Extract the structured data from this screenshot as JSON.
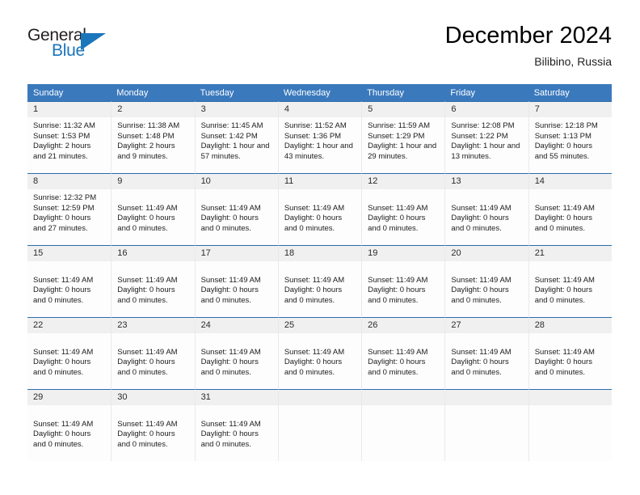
{
  "logo": {
    "text_primary": "General",
    "text_secondary": "Blue",
    "triangle_color": "#1b75bb"
  },
  "header": {
    "title": "December 2024",
    "subtitle": "Bilibino, Russia"
  },
  "theme": {
    "header_blue": "#3b79bd",
    "cell_border_blue": "#2b6cad",
    "daynum_strip_gray": "#f0f0f0",
    "cell_background": "#fdfdfd"
  },
  "calendar": {
    "weekday_headers": [
      "Sunday",
      "Monday",
      "Tuesday",
      "Wednesday",
      "Thursday",
      "Friday",
      "Saturday"
    ],
    "weeks": [
      [
        {
          "day": "1",
          "lines": [
            "Sunrise: 11:32 AM",
            "Sunset: 1:53 PM",
            "Daylight: 2 hours",
            "and 21 minutes."
          ]
        },
        {
          "day": "2",
          "lines": [
            "Sunrise: 11:38 AM",
            "Sunset: 1:48 PM",
            "Daylight: 2 hours",
            "and 9 minutes."
          ]
        },
        {
          "day": "3",
          "lines": [
            "Sunrise: 11:45 AM",
            "Sunset: 1:42 PM",
            "Daylight: 1 hour and",
            "57 minutes."
          ]
        },
        {
          "day": "4",
          "lines": [
            "Sunrise: 11:52 AM",
            "Sunset: 1:36 PM",
            "Daylight: 1 hour and",
            "43 minutes."
          ]
        },
        {
          "day": "5",
          "lines": [
            "Sunrise: 11:59 AM",
            "Sunset: 1:29 PM",
            "Daylight: 1 hour and",
            "29 minutes."
          ]
        },
        {
          "day": "6",
          "lines": [
            "Sunrise: 12:08 PM",
            "Sunset: 1:22 PM",
            "Daylight: 1 hour and",
            "13 minutes."
          ]
        },
        {
          "day": "7",
          "lines": [
            "Sunrise: 12:18 PM",
            "Sunset: 1:13 PM",
            "Daylight: 0 hours",
            "and 55 minutes."
          ]
        }
      ],
      [
        {
          "day": "8",
          "lines": [
            "Sunrise: 12:32 PM",
            "Sunset: 12:59 PM",
            "Daylight: 0 hours",
            "and 27 minutes."
          ]
        },
        {
          "day": "9",
          "lines": [
            "",
            "Sunset: 11:49 AM",
            "Daylight: 0 hours",
            "and 0 minutes."
          ]
        },
        {
          "day": "10",
          "lines": [
            "",
            "Sunset: 11:49 AM",
            "Daylight: 0 hours",
            "and 0 minutes."
          ]
        },
        {
          "day": "11",
          "lines": [
            "",
            "Sunset: 11:49 AM",
            "Daylight: 0 hours",
            "and 0 minutes."
          ]
        },
        {
          "day": "12",
          "lines": [
            "",
            "Sunset: 11:49 AM",
            "Daylight: 0 hours",
            "and 0 minutes."
          ]
        },
        {
          "day": "13",
          "lines": [
            "",
            "Sunset: 11:49 AM",
            "Daylight: 0 hours",
            "and 0 minutes."
          ]
        },
        {
          "day": "14",
          "lines": [
            "",
            "Sunset: 11:49 AM",
            "Daylight: 0 hours",
            "and 0 minutes."
          ]
        }
      ],
      [
        {
          "day": "15",
          "lines": [
            "",
            "Sunset: 11:49 AM",
            "Daylight: 0 hours",
            "and 0 minutes."
          ]
        },
        {
          "day": "16",
          "lines": [
            "",
            "Sunset: 11:49 AM",
            "Daylight: 0 hours",
            "and 0 minutes."
          ]
        },
        {
          "day": "17",
          "lines": [
            "",
            "Sunset: 11:49 AM",
            "Daylight: 0 hours",
            "and 0 minutes."
          ]
        },
        {
          "day": "18",
          "lines": [
            "",
            "Sunset: 11:49 AM",
            "Daylight: 0 hours",
            "and 0 minutes."
          ]
        },
        {
          "day": "19",
          "lines": [
            "",
            "Sunset: 11:49 AM",
            "Daylight: 0 hours",
            "and 0 minutes."
          ]
        },
        {
          "day": "20",
          "lines": [
            "",
            "Sunset: 11:49 AM",
            "Daylight: 0 hours",
            "and 0 minutes."
          ]
        },
        {
          "day": "21",
          "lines": [
            "",
            "Sunset: 11:49 AM",
            "Daylight: 0 hours",
            "and 0 minutes."
          ]
        }
      ],
      [
        {
          "day": "22",
          "lines": [
            "",
            "Sunset: 11:49 AM",
            "Daylight: 0 hours",
            "and 0 minutes."
          ]
        },
        {
          "day": "23",
          "lines": [
            "",
            "Sunset: 11:49 AM",
            "Daylight: 0 hours",
            "and 0 minutes."
          ]
        },
        {
          "day": "24",
          "lines": [
            "",
            "Sunset: 11:49 AM",
            "Daylight: 0 hours",
            "and 0 minutes."
          ]
        },
        {
          "day": "25",
          "lines": [
            "",
            "Sunset: 11:49 AM",
            "Daylight: 0 hours",
            "and 0 minutes."
          ]
        },
        {
          "day": "26",
          "lines": [
            "",
            "Sunset: 11:49 AM",
            "Daylight: 0 hours",
            "and 0 minutes."
          ]
        },
        {
          "day": "27",
          "lines": [
            "",
            "Sunset: 11:49 AM",
            "Daylight: 0 hours",
            "and 0 minutes."
          ]
        },
        {
          "day": "28",
          "lines": [
            "",
            "Sunset: 11:49 AM",
            "Daylight: 0 hours",
            "and 0 minutes."
          ]
        }
      ],
      [
        {
          "day": "29",
          "lines": [
            "",
            "Sunset: 11:49 AM",
            "Daylight: 0 hours",
            "and 0 minutes."
          ]
        },
        {
          "day": "30",
          "lines": [
            "",
            "Sunset: 11:49 AM",
            "Daylight: 0 hours",
            "and 0 minutes."
          ]
        },
        {
          "day": "31",
          "lines": [
            "",
            "Sunset: 11:49 AM",
            "Daylight: 0 hours",
            "and 0 minutes."
          ]
        },
        {
          "day": "",
          "lines": []
        },
        {
          "day": "",
          "lines": []
        },
        {
          "day": "",
          "lines": []
        },
        {
          "day": "",
          "lines": []
        }
      ]
    ]
  }
}
